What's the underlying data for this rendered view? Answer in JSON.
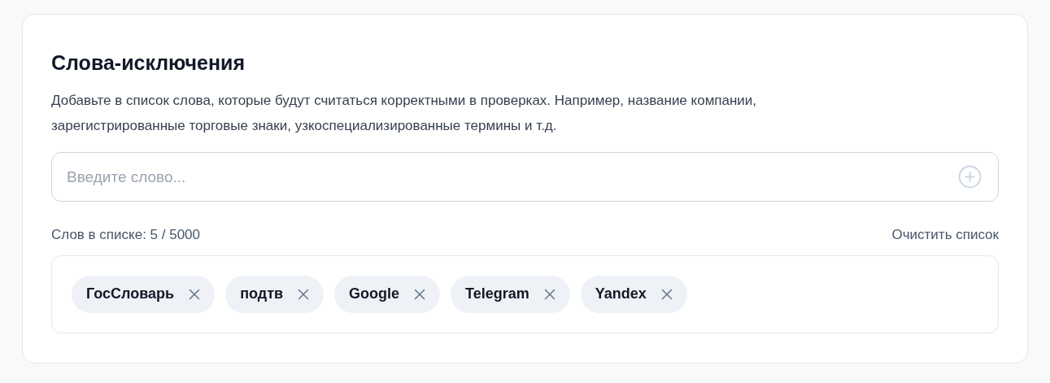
{
  "title": "Слова-исключения",
  "description": "Добавьте в список слова, которые будут считаться корректными в проверках. Например, название компании, зарегистрированные торговые знаки, узкоспециализированные термины и т.д.",
  "input": {
    "placeholder": "Введите слово..."
  },
  "count": "Слов в списке: 5 / 5000",
  "clear_link": "Очистить список",
  "tags": [
    {
      "label": "ГосСловарь"
    },
    {
      "label": "подтв"
    },
    {
      "label": "Google"
    },
    {
      "label": "Telegram"
    },
    {
      "label": "Yandex"
    }
  ]
}
